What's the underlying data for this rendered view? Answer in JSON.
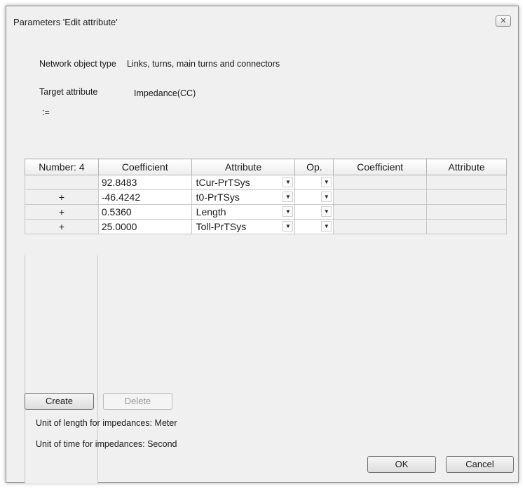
{
  "dialog": {
    "title": "Parameters 'Edit attribute'",
    "close_glyph": "✕"
  },
  "info": {
    "network_object_label": "Network object type",
    "network_object_value": "Links, turns, main turns and connectors",
    "target_attribute_label": "Target attribute",
    "target_attribute_value": "Impedance(CC)",
    "assign_symbol": ":="
  },
  "grid": {
    "headers": [
      "Number: 4",
      "Coefficient",
      "Attribute",
      "Op.",
      "Coefficient",
      "Attribute"
    ],
    "rows": [
      {
        "op": "",
        "coefficient": "92.8483",
        "attribute": "tCur-PrTSys"
      },
      {
        "op": "+",
        "coefficient": "-46.4242",
        "attribute": "t0-PrTSys"
      },
      {
        "op": "+",
        "coefficient": "0.5360",
        "attribute": "Length"
      },
      {
        "op": "+",
        "coefficient": "25.0000",
        "attribute": "Toll-PrTSys"
      }
    ],
    "dropdown_icon": "chevron-down-icon"
  },
  "buttons": {
    "create": "Create",
    "delete": "Delete",
    "ok": "OK",
    "cancel": "Cancel"
  },
  "units": {
    "length": "Unit of length for impedances: Meter",
    "time": "Unit of time for impedances: Second"
  }
}
